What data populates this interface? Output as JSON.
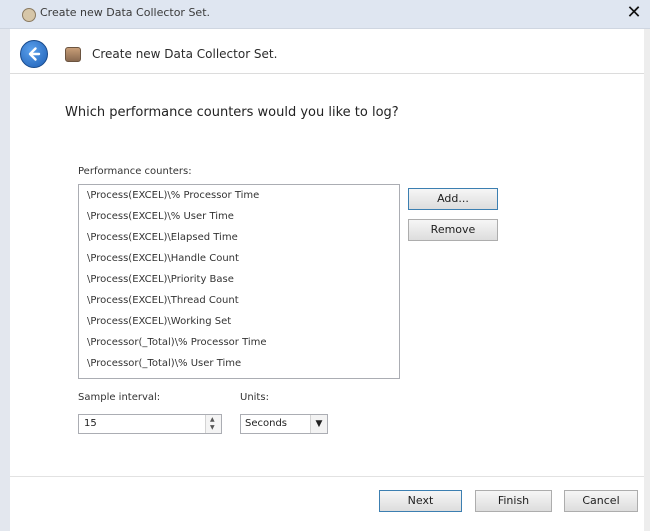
{
  "window": {
    "title": "Create new Data Collector Set.",
    "close_glyph": "✕"
  },
  "header": {
    "wizard_title": "Create new Data Collector Set."
  },
  "main": {
    "question": "Which performance counters would you like to log?",
    "counters_label": "Performance counters:",
    "counters": [
      "\\Process(EXCEL)\\% Processor Time",
      "\\Process(EXCEL)\\% User Time",
      "\\Process(EXCEL)\\Elapsed Time",
      "\\Process(EXCEL)\\Handle Count",
      "\\Process(EXCEL)\\Priority Base",
      "\\Process(EXCEL)\\Thread Count",
      "\\Process(EXCEL)\\Working Set",
      "\\Processor(_Total)\\% Processor Time",
      "\\Processor(_Total)\\% User Time"
    ],
    "add_label": "Add...",
    "remove_label": "Remove",
    "sample_interval_label": "Sample interval:",
    "sample_interval_value": "15",
    "units_label": "Units:",
    "units_value": "Seconds"
  },
  "footer": {
    "next_label": "Next",
    "finish_label": "Finish",
    "cancel_label": "Cancel"
  },
  "icons": {
    "app": "data-collector-icon",
    "back": "back-arrow-icon",
    "wizard": "data-collector-icon",
    "close": "close-icon",
    "spin_up": "spin-up-icon",
    "spin_down": "spin-down-icon",
    "dropdown": "chevron-down-icon"
  },
  "colors": {
    "titlebar": "#dfe6f1",
    "back_button": "#1e5fb5",
    "default_button_border": "#3c7fb1"
  }
}
